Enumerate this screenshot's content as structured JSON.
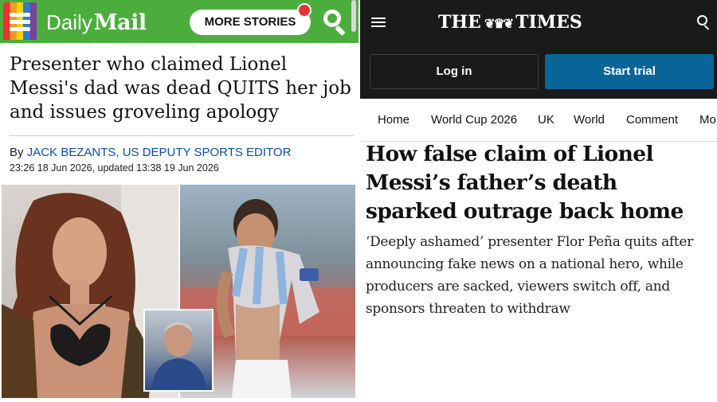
{
  "dailymail": {
    "logo_daily": "Daily",
    "logo_mail": "Mail",
    "more_stories": "MORE STORIES",
    "headline": "Presenter who claimed Lionel Messi's dad was dead QUITS her job and issues groveling apology",
    "byline_prefix": "By ",
    "byline_author": "JACK BEZANTS, US DEPUTY SPORTS EDITOR",
    "dateline": "23:26 18 Jun 2026, updated 13:38 19 Jun 2026",
    "brand_colors": {
      "header": "#4bae3c",
      "byline": "#0a4fa0"
    },
    "icons": [
      "menu-icon",
      "search-icon",
      "notification-dot-icon"
    ]
  },
  "times": {
    "logo_left": "THE",
    "logo_right": "TIMES",
    "login": "Log in",
    "trial": "Start trial",
    "nav": [
      "Home",
      "World Cup 2026",
      "UK",
      "World",
      "Comment",
      "Mo"
    ],
    "headline": "How false claim of Lionel Messi’s father’s death sparked outrage back home",
    "standfirst": "‘Deeply ashamed’ presenter Flor Peña quits after announcing fake news on a national hero, while producers are sacked, viewers switch off, and sponsors threaten to withdraw",
    "brand_colors": {
      "topbar": "#1a1a1a",
      "trial_button": "#0a6497"
    },
    "icons": [
      "menu-icon",
      "search-icon",
      "crest-icon"
    ]
  }
}
